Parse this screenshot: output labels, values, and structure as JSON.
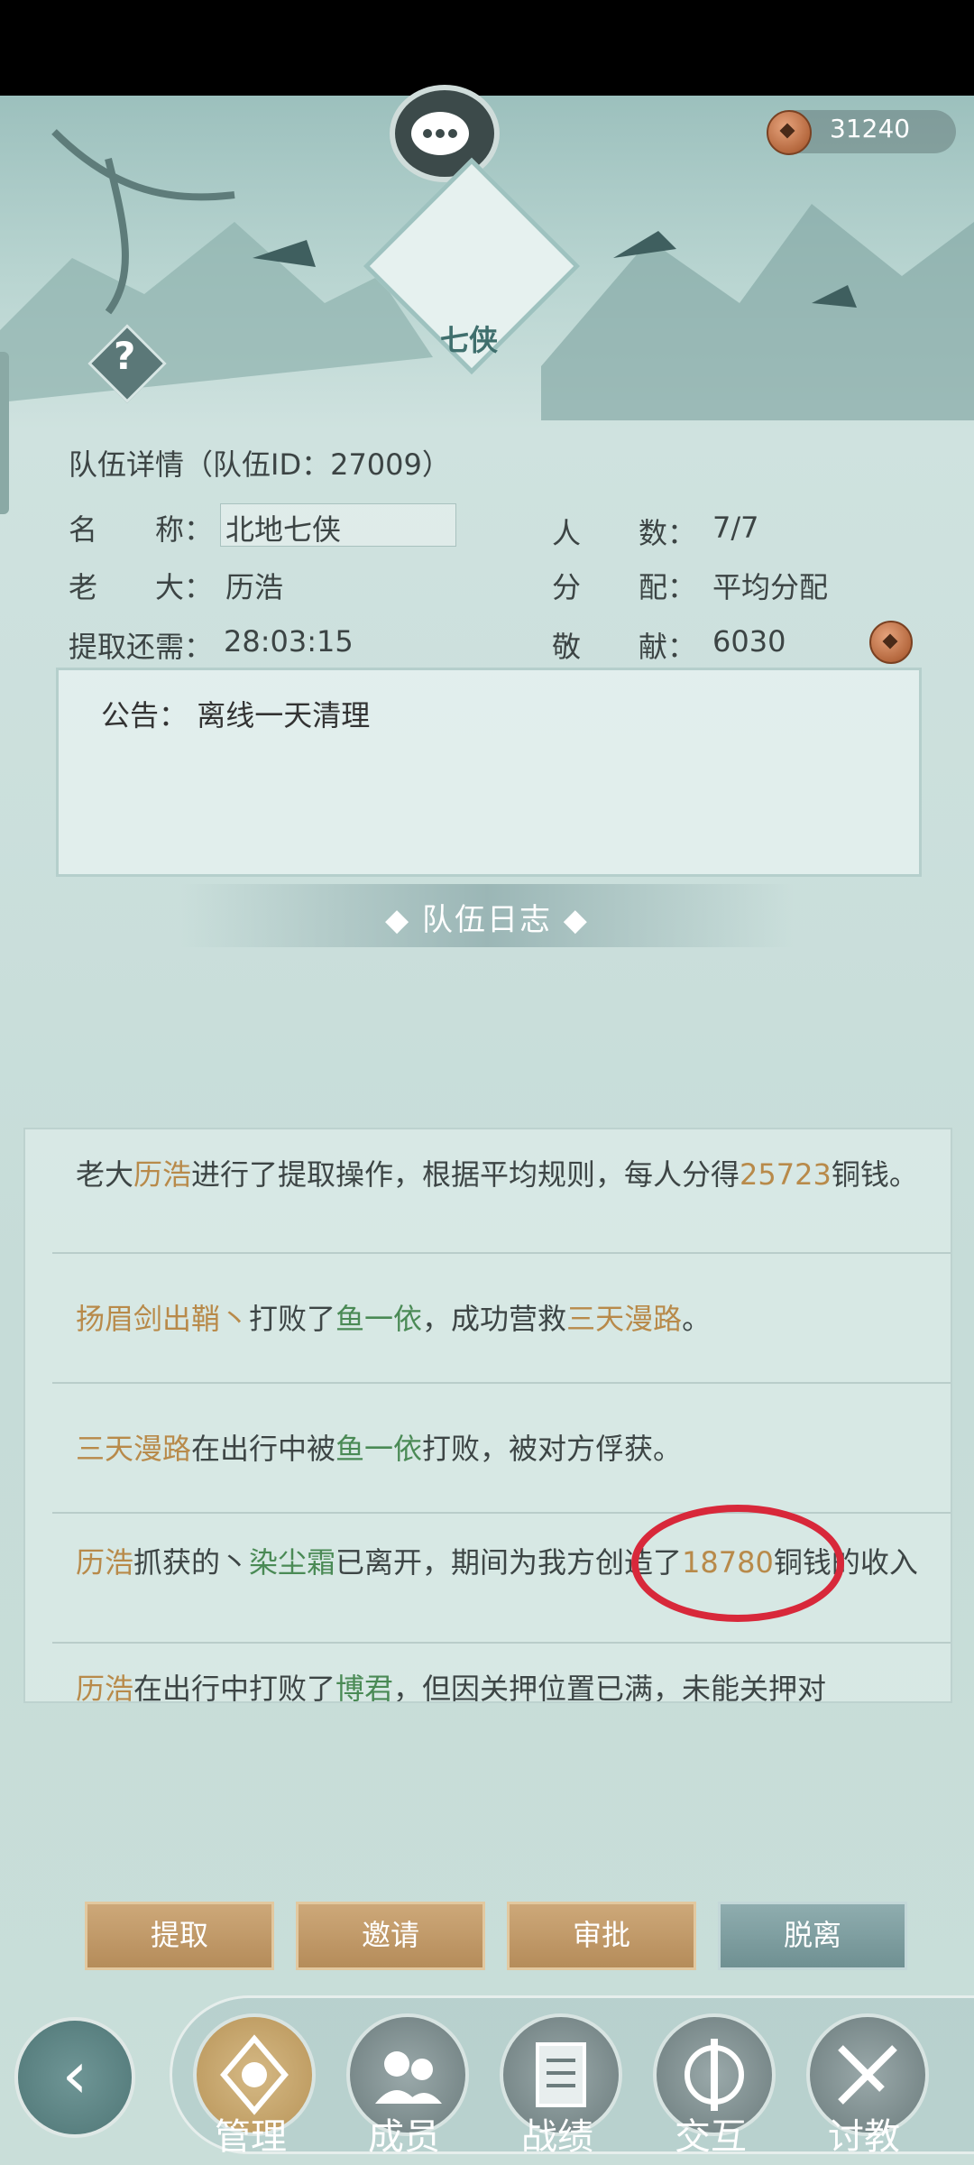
{
  "currency": {
    "amount": "31240",
    "icon": "copper-coin-icon"
  },
  "emblem": {
    "text": "七侠"
  },
  "help": {
    "text": "?"
  },
  "team": {
    "title": "队伍详情（队伍ID：27009）",
    "name_label": "名　　称：",
    "name_value": "北地七侠",
    "members_label": "人　　数：",
    "members_value": "7/7",
    "leader_label": "老　　大：",
    "leader_value": "历浩",
    "distribution_label": "分　　配：",
    "distribution_value": "平均分配",
    "withdraw_label": "提取还需：",
    "withdraw_value": "28:03:15",
    "contribution_label": "敬　　献：",
    "contribution_value": "6030"
  },
  "notice": {
    "label": "公告：",
    "text": "离线一天清理"
  },
  "log": {
    "header": "◆ 队伍日志 ◆",
    "entries": [
      {
        "parts": [
          "老大",
          "历浩",
          "进行了提取操作，根据平均规则，每人分得",
          "25723",
          "铜钱。"
        ]
      },
      {
        "parts": [
          "扬眉剑出鞘丶",
          "打败了",
          "鱼一依",
          "，成功营救",
          "三天漫路",
          "。"
        ]
      },
      {
        "parts": [
          "三天漫路",
          "在出行中被",
          "鱼一依",
          "打败，被对方俘获。"
        ]
      },
      {
        "parts": [
          "历浩",
          "抓获的丶",
          "染尘霜",
          "已离开，期间为我方创造了",
          "18780",
          "铜钱的收入"
        ]
      },
      {
        "parts": [
          "历浩",
          "在出行中打败了",
          "博君",
          "，但因关押位置已满，未能关押对"
        ]
      }
    ]
  },
  "actions": {
    "withdraw": "提取",
    "invite": "邀请",
    "approve": "审批",
    "leave": "脱离"
  },
  "nav": {
    "back_icon": "back-arrow-icon",
    "items": [
      {
        "label": "管理",
        "icon": "manage-icon"
      },
      {
        "label": "成员",
        "icon": "members-icon"
      },
      {
        "label": "战绩",
        "icon": "record-scroll-icon"
      },
      {
        "label": "交互",
        "icon": "interact-icon"
      },
      {
        "label": "讨教",
        "icon": "duel-icon"
      }
    ]
  },
  "colors": {
    "highlight_name": "#b88a4a",
    "highlight_green": "#4a8a55",
    "annotation_red": "#d8283a"
  }
}
